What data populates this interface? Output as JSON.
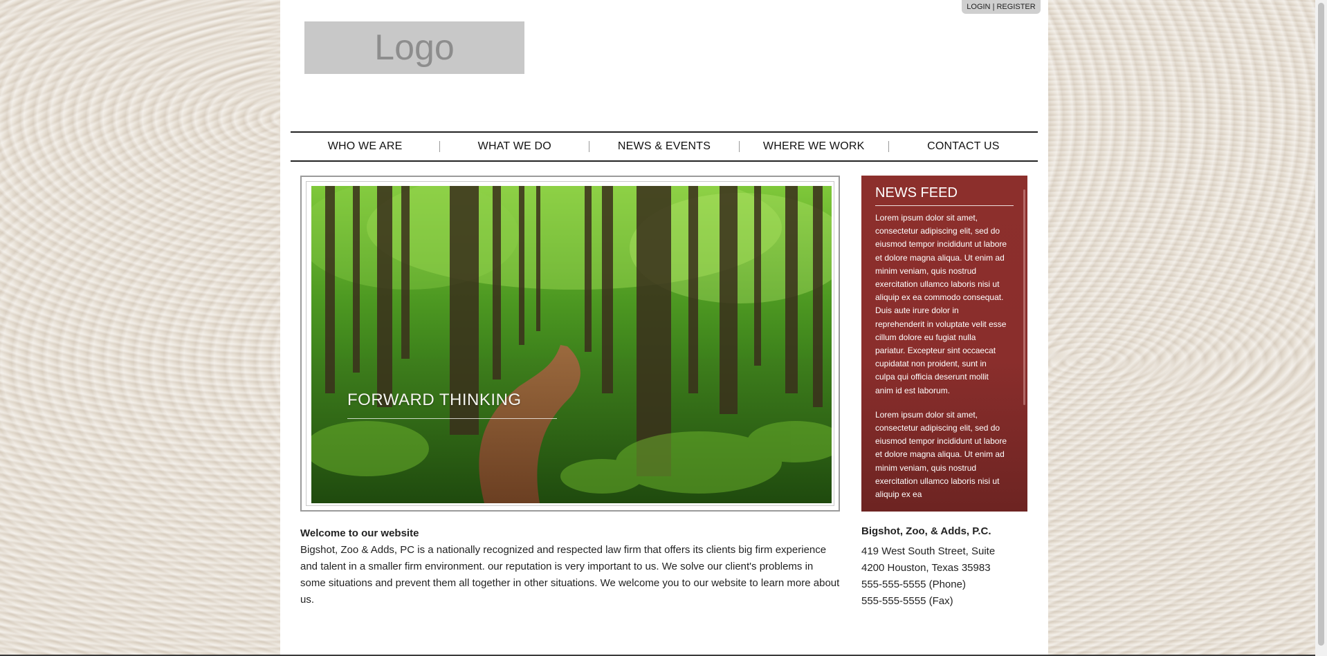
{
  "header": {
    "login": "LOGIN",
    "separator": "|",
    "register": "REGISTER",
    "logo_text": "Logo"
  },
  "nav": {
    "items": [
      {
        "label": "WHO WE ARE"
      },
      {
        "label": "WHAT WE DO"
      },
      {
        "label": "NEWS & EVENTS"
      },
      {
        "label": "WHERE WE WORK"
      },
      {
        "label": "CONTACT US"
      }
    ]
  },
  "hero": {
    "caption": "FORWARD THINKING"
  },
  "news_feed": {
    "title": "NEWS FEED",
    "paragraphs": [
      "Lorem ipsum dolor sit amet, consectetur adipiscing elit, sed do eiusmod tempor incididunt ut labore et dolore magna aliqua. Ut enim ad minim veniam, quis nostrud exercitation ullamco laboris nisi ut aliquip ex ea commodo consequat. Duis aute irure dolor in reprehenderit in voluptate velit esse cillum dolore eu fugiat nulla pariatur. Excepteur sint occaecat cupidatat non proident, sunt in culpa qui officia deserunt mollit anim id est laborum.",
      "Lorem ipsum dolor sit amet, consectetur adipiscing elit, sed do eiusmod tempor incididunt ut labore et dolore magna aliqua. Ut enim ad minim veniam, quis nostrud exercitation ullamco laboris nisi ut aliquip ex ea"
    ]
  },
  "welcome": {
    "heading": "Welcome to our website",
    "body": "Bigshot, Zoo & Adds, PC is a nationally recognized and respected law firm that offers its clients big firm experience and talent in a smaller firm environment. our reputation is very important to us. We solve our client's problems in some situations and prevent them all together in other situations. We welcome you to our website to learn more about us."
  },
  "contact": {
    "firm_name": "Bigshot, Zoo, & Adds, P.C.",
    "address_line1": "419 West South Street, Suite",
    "address_line2": "4200 Houston, Texas 35983",
    "phone": "555-555-5555 (Phone)",
    "fax": "555-555-5555 (Fax)"
  },
  "colors": {
    "news_bg": "#8c2f2c",
    "page_bg": "#ffffff",
    "wood_bg": "#e6ded2"
  }
}
